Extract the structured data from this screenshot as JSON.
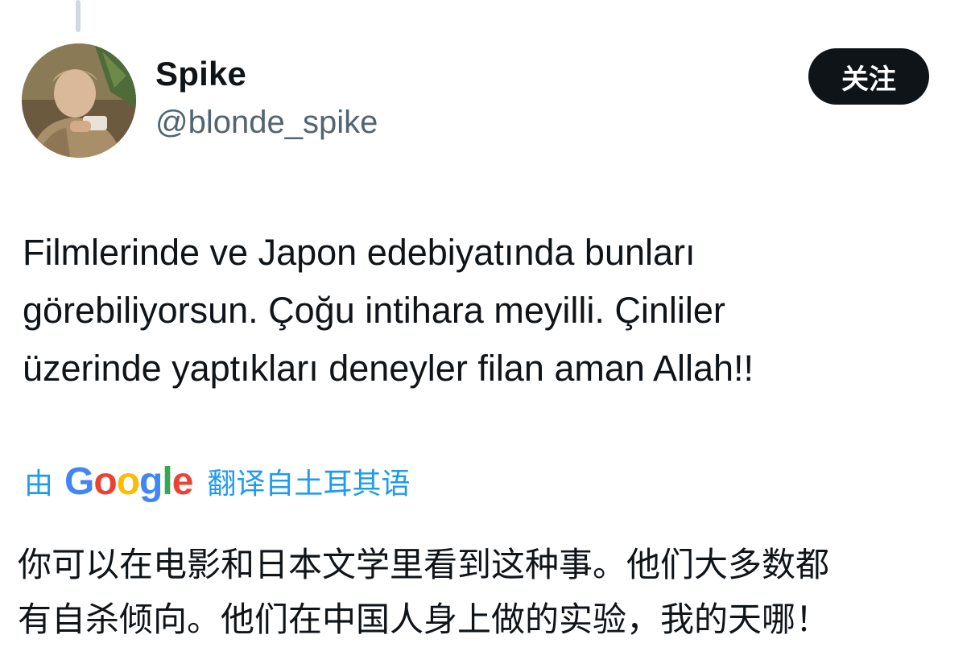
{
  "author": {
    "name": "Spike",
    "handle": "@blonde_spike"
  },
  "follow_button": {
    "label": "关注"
  },
  "tweet": {
    "lines": [
      "Filmlerinde ve Japon edebiyatında bunları",
      "görebiliyorsun. Çoğu intihara meyilli. Çinliler",
      "üzerinde yaptıkları deneyler filan aman Allah!!"
    ]
  },
  "translation": {
    "by": "由",
    "provider_letters": [
      "G",
      "o",
      "o",
      "g",
      "l",
      "e"
    ],
    "suffix": "翻译自土耳其语",
    "lines": [
      "你可以在电影和日本文学里看到这种事。他们大多数都",
      "有自杀倾向。他们在中国人身上做的实验，我的天哪！"
    ]
  },
  "colors": {
    "text": "#0f1419",
    "secondary": "#536471",
    "link": "#1d9bf0",
    "button_bg": "#0f1419"
  },
  "icons": {
    "avatar": "profile-photo"
  }
}
